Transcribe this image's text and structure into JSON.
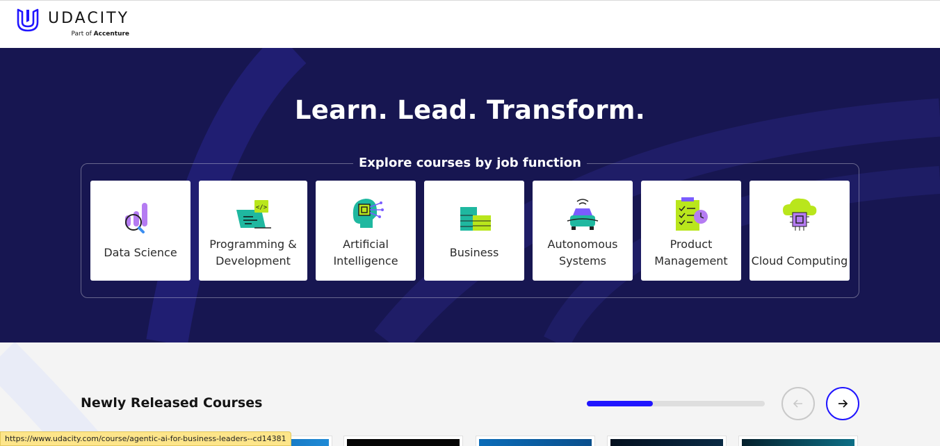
{
  "brand": {
    "name": "UDACITY",
    "tagline_prefix": "Part of",
    "tagline_company": "Accenture",
    "accent_color": "#2015ff",
    "hero_color": "#171651"
  },
  "hero": {
    "title": "Learn. Lead. Transform.",
    "explore_label": "Explore courses by job function",
    "categories": [
      {
        "label": "Data Science",
        "icon": "data-science-icon"
      },
      {
        "label": "Programming & Development",
        "icon": "programming-icon"
      },
      {
        "label": "Artificial Intelligence",
        "icon": "ai-head-icon"
      },
      {
        "label": "Business",
        "icon": "buildings-icon"
      },
      {
        "label": "Autonomous Systems",
        "icon": "autonomous-car-icon"
      },
      {
        "label": "Product Management",
        "icon": "clipboard-checklist-icon"
      },
      {
        "label": "Cloud Computing",
        "icon": "cloud-chip-icon"
      }
    ]
  },
  "newly_released": {
    "title": "Newly Released Courses",
    "carousel_progress": 0.37,
    "prev_icon": "arrow-left-icon",
    "next_icon": "arrow-right-icon"
  },
  "status_bar": {
    "url": "https://www.udacity.com/course/agentic-ai-for-business-leaders--cd14381"
  }
}
